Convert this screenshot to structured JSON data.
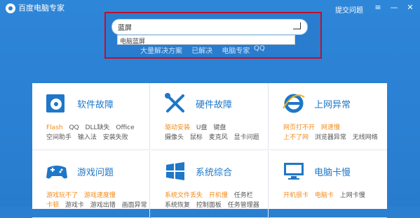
{
  "app": {
    "title": "百度电脑专家",
    "feedback": "提交问题"
  },
  "search": {
    "value": "蓝屏",
    "suggestion": "电脑蓝屏"
  },
  "links": {
    "items": [
      "大量解决方案",
      "已解决",
      "电脑专家"
    ],
    "qq": "QQ"
  },
  "cards": [
    {
      "title": "软件故障",
      "row1": [
        "Flash",
        "QQ",
        "DLL缺失",
        "Office"
      ],
      "row2": [
        "空间助手",
        "输入法",
        "安装失败"
      ]
    },
    {
      "title": "硬件故障",
      "row1": [
        "驱动安装",
        "U盘",
        "键盘"
      ],
      "row2": [
        "摄像头",
        "鼠标",
        "麦克风",
        "显卡问题"
      ]
    },
    {
      "title": "上网异常",
      "row1": [
        "网页打不开",
        "网速慢"
      ],
      "row2": [
        "上不了网",
        "浏览器异常",
        "无线网络"
      ]
    },
    {
      "title": "游戏问题",
      "row1": [
        "游戏玩不了",
        "游戏速度慢"
      ],
      "row2": [
        "卡顿",
        "游戏卡",
        "游戏出错",
        "画面异常"
      ]
    },
    {
      "title": "系统综合",
      "row1": [
        "系统文件丢失",
        "开机慢",
        "任务栏"
      ],
      "row2": [
        "系统恢复",
        "控制面板",
        "任务管理器"
      ]
    },
    {
      "title": "电脑卡慢",
      "row1": [
        "开机很卡",
        "电脑卡",
        "上网卡慢"
      ],
      "row2": []
    }
  ],
  "colors": {
    "accent": "#1e77c8",
    "warning": "#f28a1a",
    "frame": "#c0102a"
  }
}
